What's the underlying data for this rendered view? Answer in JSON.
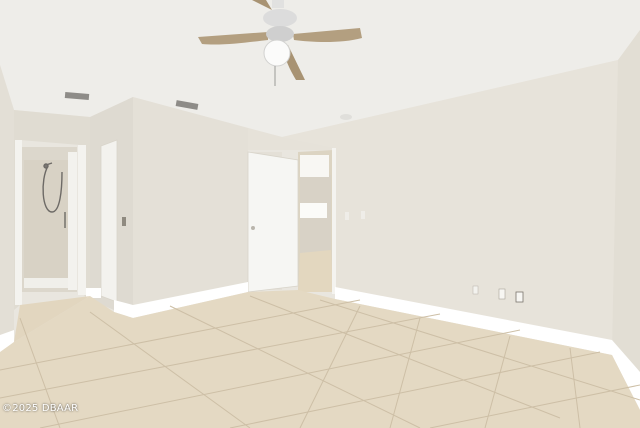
{
  "scene": {
    "description_free": true,
    "watermark": "©2025 DBAAR"
  },
  "palette": {
    "ceiling": "#eeede9",
    "wall_main": "#e7e3da",
    "wall_shadow": "#dcd8cf",
    "wall_left": "#e2ded4",
    "baseboard": "#ffffff",
    "floor_tile": "#e4d9c3",
    "grout": "#cfc2aa",
    "door": "#f5f5f2",
    "fan_blade": "#b39f80",
    "fan_metal": "#dcdcdc"
  },
  "icons": [
    "ceiling-fan-icon",
    "air-vent-icon",
    "shower-head-icon",
    "door-hinge-icon",
    "outlet-icon",
    "light-switch-icon"
  ]
}
